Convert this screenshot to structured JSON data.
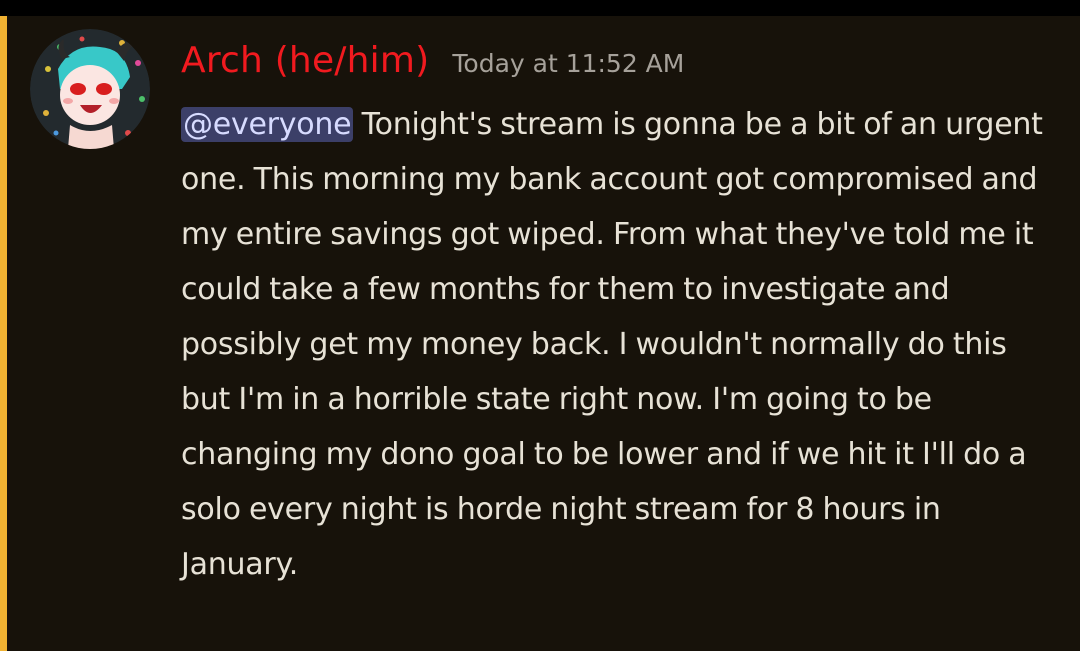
{
  "message": {
    "author": {
      "display_name": "Arch (he/him)",
      "name_color": "#f11a1f",
      "avatar_icon": "avatar-icon"
    },
    "timestamp": "Today at 11:52 AM",
    "mention": "@everyone",
    "body": " Tonight's stream is gonna be a bit of an urgent one. This morning my bank account got compromised and my entire savings got wiped. From what they've told me it could take a few months for them to investigate and possibly get my money back. I wouldn't normally do this but I'm in a horrible state right now. I'm going to be changing my dono goal to be lower and if we hit it I'll do a solo every night is horde night stream for 8 hours in January.",
    "highlight_color": "#f0b232"
  }
}
